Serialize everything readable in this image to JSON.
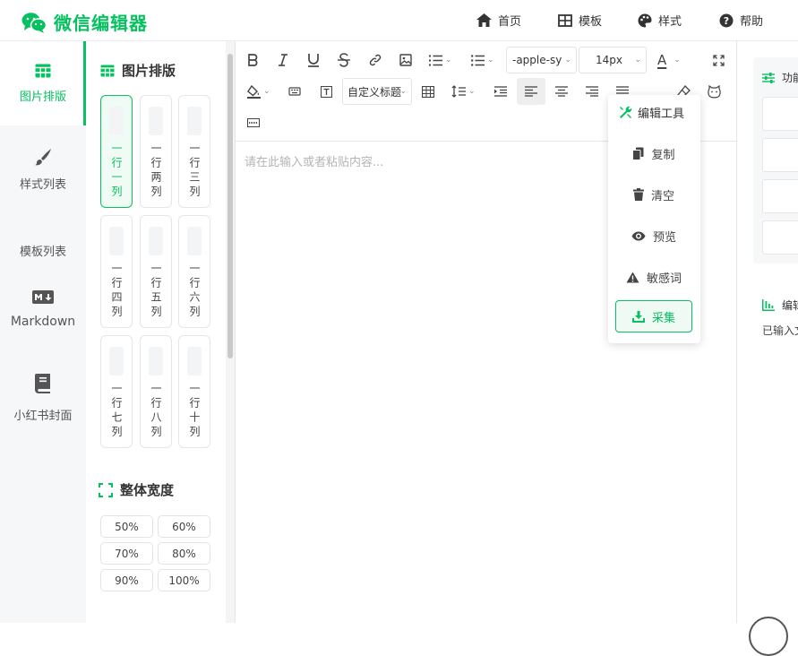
{
  "app": {
    "title": "微信编辑器",
    "brand_color": "#07c160"
  },
  "topnav": [
    {
      "label": "首页",
      "icon": "home-icon"
    },
    {
      "label": "模板",
      "icon": "grid-icon"
    },
    {
      "label": "样式",
      "icon": "palette-icon"
    },
    {
      "label": "帮助",
      "icon": "help-icon"
    }
  ],
  "sidebar": {
    "items": [
      {
        "label": "图片排版",
        "icon": "table-icon",
        "active": true
      },
      {
        "label": "样式列表",
        "icon": "brush-icon"
      },
      {
        "label": "模板列表",
        "icon": ""
      },
      {
        "label": "Markdown",
        "icon": "markdown-icon"
      },
      {
        "label": "小红书封面",
        "icon": "book-icon"
      }
    ]
  },
  "layout_panel": {
    "title": "图片排版",
    "cards": [
      "一行一列",
      "一行两列",
      "一行三列",
      "一行四列",
      "一行五列",
      "一行六列",
      "一行七列",
      "一行八列",
      "一行十列"
    ],
    "width_title": "整体宽度",
    "width_options": [
      "50%",
      "60%",
      "70%",
      "80%",
      "90%",
      "100%"
    ]
  },
  "toolbar": {
    "font_family": "-apple-sy",
    "font_size": "14px",
    "heading_select": "自定义标题",
    "text_color_letter": "A"
  },
  "editor": {
    "placeholder": "请在此输入或者粘贴内容..."
  },
  "popup": {
    "title": "编辑工具",
    "items": [
      {
        "label": "复制",
        "icon": "copy-icon"
      },
      {
        "label": "清空",
        "icon": "trash-icon"
      },
      {
        "label": "预览",
        "icon": "eye-icon"
      },
      {
        "label": "敏感词",
        "icon": "warning-icon"
      },
      {
        "label": "采集",
        "icon": "download-icon",
        "highlight": true
      }
    ]
  },
  "right_panel": {
    "title": "功能",
    "section2_title": "编辑",
    "text": "已输入文"
  }
}
